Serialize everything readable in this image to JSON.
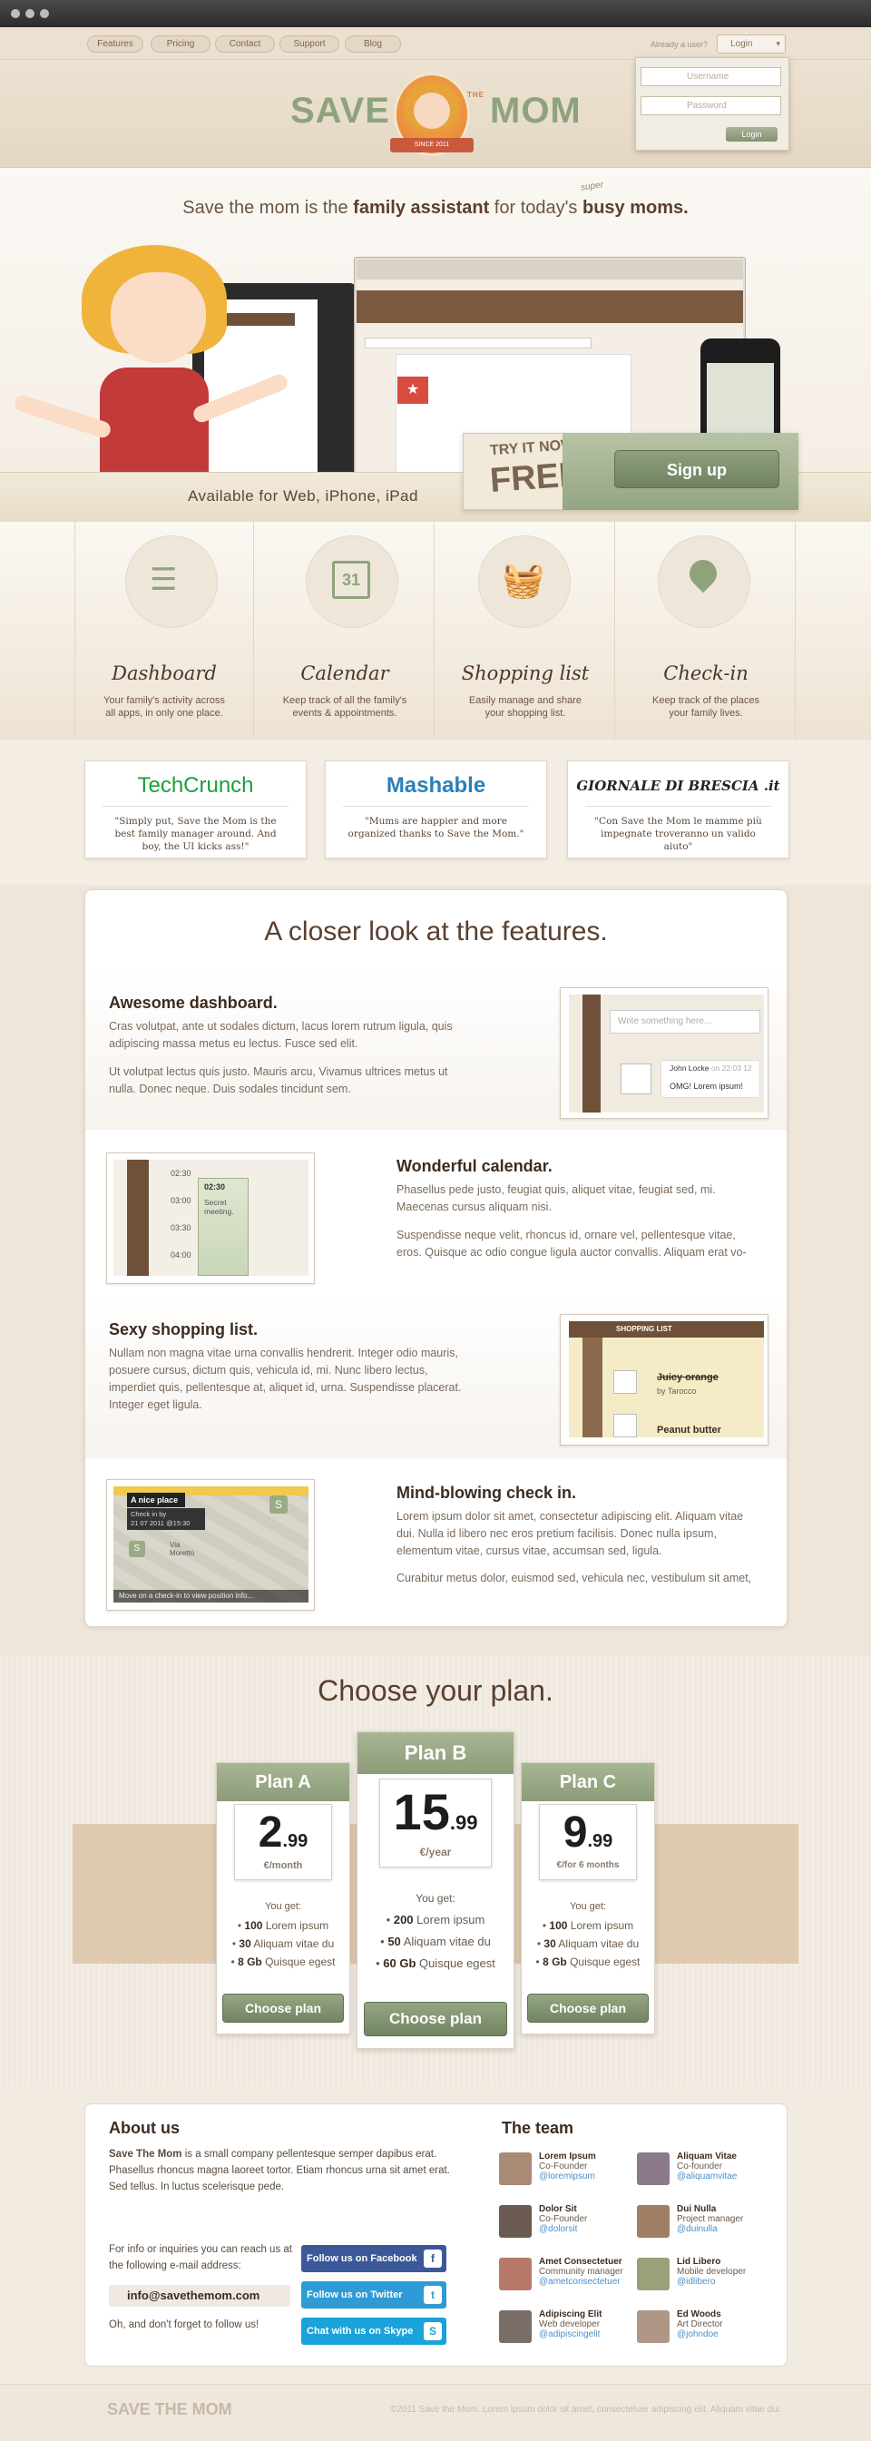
{
  "nav": {
    "items": [
      "Features",
      "Pricing",
      "Contact",
      "Support",
      "Blog"
    ],
    "already": "Already a user?",
    "login": "Login"
  },
  "login_form": {
    "username_placeholder": "Username",
    "password_placeholder": "Password",
    "submit": "Login"
  },
  "logo": {
    "left": "SAVE",
    "the": "THE",
    "right": "MOM",
    "since": "SINCE 2011"
  },
  "hero": {
    "tagline_pre": "Save the mom is the ",
    "tagline_bold1": "family assistant",
    "tagline_mid": " for today's ",
    "tagline_super": "super",
    "tagline_bold2": "busy moms.",
    "available": "Available for Web, iPhone, iPad",
    "try_line1": "TRY IT NOW,",
    "try_line2": "FREE!",
    "signup": "Sign up"
  },
  "features": [
    {
      "title": "Dashboard",
      "desc": "Your family's activity across all apps, in only one place.",
      "icon": "list-icon"
    },
    {
      "title": "Calendar",
      "desc": "Keep track of all the family's events & appointments.",
      "icon": "calendar-icon",
      "icon_text": "31"
    },
    {
      "title": "Shopping list",
      "desc": "Easily manage and share your shopping list.",
      "icon": "basket-icon"
    },
    {
      "title": "Check-in",
      "desc": "Keep track of the places your family lives.",
      "icon": "map-pin-icon"
    }
  ],
  "press": [
    {
      "logo": "TechCrunch",
      "quote": "\"Simply put, Save the Mom is the best family manager around. And boy, the UI kicks ass!\"",
      "color": "#1f9e3a"
    },
    {
      "logo": "Mashable",
      "quote": "\"Mums are happier and more organized thanks to Save the Mom.\"",
      "color": "#2a80b9"
    },
    {
      "logo": "GIORNALE DI BRESCIA .it",
      "quote": "\"Con Save the Mom le mamme più impegnate troveranno un valido aiuto\"",
      "color": "#222222"
    }
  ],
  "closer": {
    "title": "A closer look at the features.",
    "items": [
      {
        "title": "Awesome dashboard.",
        "p1": "Cras volutpat, ante ut sodales dictum, lacus lorem rutrum ligula, quis adipiscing massa metus eu lectus. Fusce sed elit.",
        "p2": "Ut volutpat lectus quis justo. Mauris arcu, Vivamus ultrices metus ut nulla. Donec neque. Duis sodales tincidunt sem.",
        "shot": {
          "input": "Write something here...",
          "user": "John Locke",
          "time": "on 22:03 12",
          "msg": "OMG! Lorem ipsum!"
        }
      },
      {
        "title": "Wonderful calendar.",
        "p1": "Phasellus pede justo, feugiat quis, aliquet vitae, feugiat sed, mi. Maecenas cursus aliquam nisi.",
        "p2": "Suspendisse neque velit, rhoncus id, ornare vel, pellentesque vitae, eros. Quisque ac odio congue ligula auctor convallis. Aliquam erat vo-",
        "shot": {
          "times": [
            "02:30",
            "03:00",
            "03:30",
            "04:00"
          ],
          "event_time": "02:30",
          "event": "Secret meeting."
        }
      },
      {
        "title": "Sexy shopping list.",
        "p1": "Nullam non magna vitae urna convallis hendrerit. Integer odio mauris, posuere cursus, dictum quis, vehicula id, mi. Nunc libero lectus, imperdiet quis, pellentesque at, aliquet id, urna. Suspendisse placerat. Integer eget ligula.",
        "shot": {
          "header": "SHOPPING LIST",
          "item1": "Juicy orange",
          "item1_by": "by Tarocco",
          "item2": "Peanut butter"
        }
      },
      {
        "title": "Mind-blowing check in.",
        "p1": "Lorem ipsum dolor sit amet, consectetur adipiscing elit. Aliquam vitae dui. Nulla id libero nec eros pretium facilisis. Donec nulla ipsum, elementum vitae, cursus vitae, accumsan sed, ligula.",
        "p2": "Curabitur metus dolor, euismod sed, vehicula nec, vestibulum sit amet,",
        "shot": {
          "place": "A nice place",
          "checkin": "Check in by",
          "date": "21 07 2011 @15:30",
          "street": "Via Moretto",
          "move": "Move on a check-in to view position info..."
        }
      }
    ]
  },
  "plans": {
    "title": "Choose your plan.",
    "you_get": "You get:",
    "choose": "Choose plan",
    "items": [
      {
        "name": "Plan A",
        "price_big": "2",
        "price_small": ".99",
        "per": "€/month",
        "lines": [
          [
            "100",
            "Lorem ipsum"
          ],
          [
            "30",
            "Aliquam vitae du"
          ],
          [
            "8 Gb",
            "Quisque egest"
          ]
        ]
      },
      {
        "name": "Plan B",
        "price_big": "15",
        "price_small": ".99",
        "per": "€/year",
        "lines": [
          [
            "200",
            "Lorem ipsum"
          ],
          [
            "50",
            "Aliquam vitae du"
          ],
          [
            "60 Gb",
            "Quisque egest"
          ]
        ]
      },
      {
        "name": "Plan C",
        "price_big": "9",
        "price_small": ".99",
        "per": "€/for 6 months",
        "lines": [
          [
            "100",
            "Lorem ipsum"
          ],
          [
            "30",
            "Aliquam vitae du"
          ],
          [
            "8 Gb",
            "Quisque egest"
          ]
        ]
      }
    ]
  },
  "about": {
    "title": "About us",
    "brand": "Save The Mom",
    "text": " is a small company pellentesque semper dapibus erat. Phasellus rhoncus magna laoreet tortor. Etiam rhoncus urna sit amet erat. Sed tellus. In luctus scelerisque pede.",
    "contact": "For info or inquiries you can reach us at the following e-mail address:",
    "email": "info@savethemom.com",
    "follow": "Oh, and don't forget to follow us!",
    "social": [
      {
        "label": "Follow us on Facebook",
        "icon": "facebook-icon",
        "glyph": "f",
        "color": "#3b5998"
      },
      {
        "label": "Follow us on Twitter",
        "icon": "twitter-icon",
        "glyph": "t",
        "color": "#2e9bd6"
      },
      {
        "label": "Chat with us on Skype",
        "icon": "skype-icon",
        "glyph": "S",
        "color": "#1aa2db"
      }
    ]
  },
  "team": {
    "title": "The team",
    "members": [
      {
        "name": "Lorem Ipsum",
        "role": "Co-Founder",
        "handle": "@loremipsum"
      },
      {
        "name": "Aliquam Vitae",
        "role": "Co-founder",
        "handle": "@aliquamvitae"
      },
      {
        "name": "Dolor Sit",
        "role": "Co-Founder",
        "handle": "@dolorsit"
      },
      {
        "name": "Dui Nulla",
        "role": "Project manager",
        "handle": "@duinulla"
      },
      {
        "name": "Amet Consectetuer",
        "role": "Community manager",
        "handle": "@ametconsectetuer"
      },
      {
        "name": "Lid Libero",
        "role": "Mobile developer",
        "handle": "@idlibero"
      },
      {
        "name": "Adipiscing Elit",
        "role": "Web developer",
        "handle": "@adipiscingelit"
      },
      {
        "name": "Ed Woods",
        "role": "Art Director",
        "handle": "@johndoe"
      }
    ]
  },
  "footer": {
    "logo": "SAVE THE MOM",
    "copy": "©2011 Save the Mom.  Lorem ipsum dolor sit amet, consectetuer adipiscing elit. Aliquam vitae dui."
  }
}
